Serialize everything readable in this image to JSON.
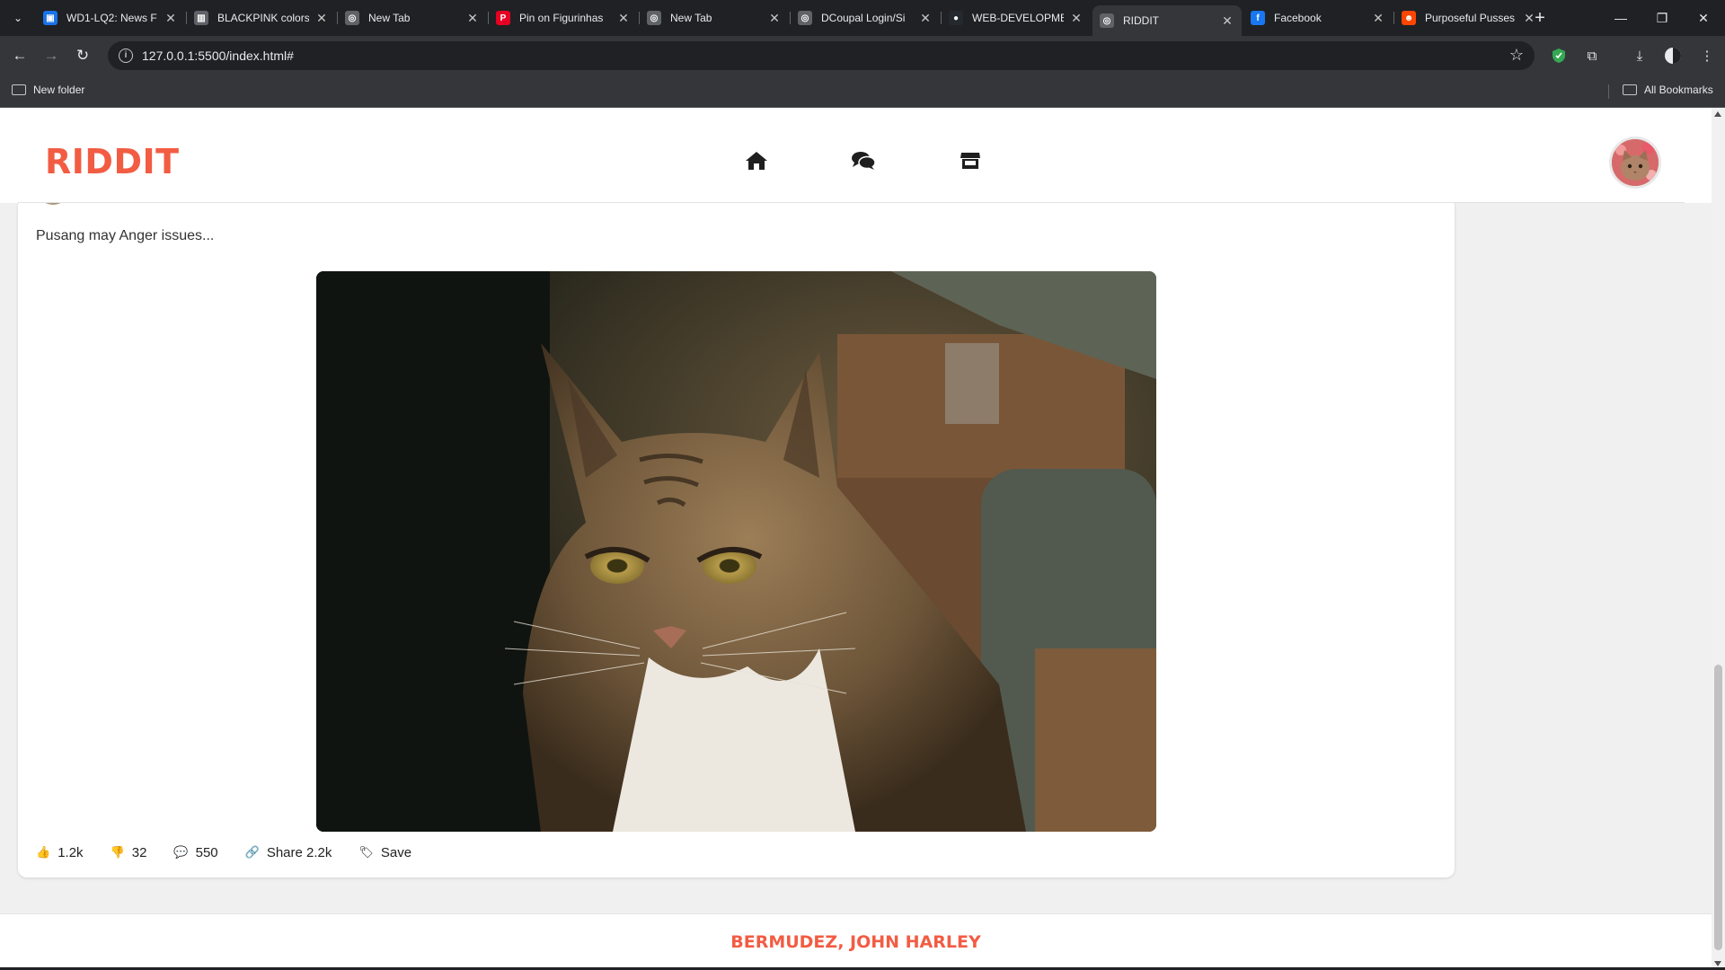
{
  "browser": {
    "tabs": [
      {
        "label": "WD1-LQ2: News F",
        "favicon_color": "#1a73e8",
        "favicon_glyph": "▣"
      },
      {
        "label": "BLACKPINK colors",
        "favicon_color": "#5f6368",
        "favicon_glyph": "▥"
      },
      {
        "label": "New Tab",
        "favicon_color": "#5f6368",
        "favicon_glyph": "◎"
      },
      {
        "label": "Pin on Figurinhas",
        "favicon_color": "#e60023",
        "favicon_glyph": "P"
      },
      {
        "label": "New Tab",
        "favicon_color": "#5f6368",
        "favicon_glyph": "◎"
      },
      {
        "label": "DCoupal Login/Si",
        "favicon_color": "#5f6368",
        "favicon_glyph": "◎"
      },
      {
        "label": "WEB-DEVELOPME",
        "favicon_color": "#24292f",
        "favicon_glyph": "●"
      },
      {
        "label": "RIDDIT",
        "favicon_color": "#5f6368",
        "favicon_glyph": "◎"
      },
      {
        "label": "Facebook",
        "favicon_color": "#1877f2",
        "favicon_glyph": "f"
      },
      {
        "label": "Purposeful Pusses",
        "favicon_color": "#ff4500",
        "favicon_glyph": "☻"
      }
    ],
    "active_tab_index": 7,
    "url": "127.0.0.1:5500/index.html#",
    "bookmarks": {
      "folder": "New folder",
      "all": "All Bookmarks"
    }
  },
  "app": {
    "logo": "RIDDIT",
    "nav_icons": [
      "home-icon",
      "chat-icon",
      "store-icon"
    ],
    "accent_color": "#f25c43"
  },
  "post": {
    "text": "Pusang may Anger issues...",
    "actions": {
      "likes": "1.2k",
      "dislikes": "32",
      "comments": "550",
      "share": "Share 2.2k",
      "save": "Save"
    }
  },
  "footer": {
    "name": "BERMUDEZ, JOHN HARLEY"
  }
}
